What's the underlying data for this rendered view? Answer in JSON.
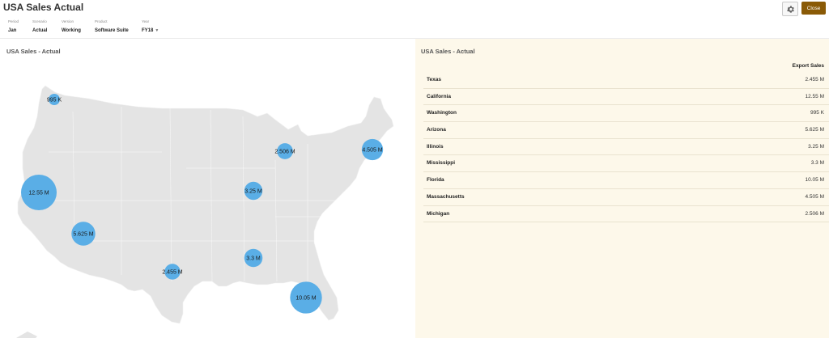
{
  "app": {
    "title": "USA Sales Actual",
    "close_label": "Close"
  },
  "icons": {
    "settings": "gear-icon",
    "year_dropdown": "chevron-down-icon"
  },
  "colors": {
    "bubble": "#5aaee6",
    "map_fill": "#e4e4e4",
    "close_button": "#8a5a06",
    "table_panel": "#fdf8ea"
  },
  "pov": [
    {
      "label": "Period",
      "value": "Jan"
    },
    {
      "label": "Scenario",
      "value": "Actual"
    },
    {
      "label": "Version",
      "value": "Working"
    },
    {
      "label": "Product",
      "value": "Software Suite"
    },
    {
      "label": "Year",
      "value": "FY18"
    }
  ],
  "map_panel": {
    "title": "USA Sales - Actual",
    "bubbles": [
      {
        "state": "Washington",
        "label": "995 K",
        "value": 995000
      },
      {
        "state": "California",
        "label": "12.55 M",
        "value": 12550000
      },
      {
        "state": "Arizona",
        "label": "5.625 M",
        "value": 5625000
      },
      {
        "state": "Texas",
        "label": "2.455 M",
        "value": 2455000
      },
      {
        "state": "Illinois",
        "label": "3.25 M",
        "value": 3250000
      },
      {
        "state": "Mississippi",
        "label": "3.3 M",
        "value": 3300000
      },
      {
        "state": "Michigan",
        "label": "2.506 M",
        "value": 2506000
      },
      {
        "state": "Massachusetts",
        "label": "4.505 M",
        "value": 4505000
      },
      {
        "state": "Florida",
        "label": "10.05 M",
        "value": 10050000
      }
    ]
  },
  "table_panel": {
    "title": "USA Sales - Actual",
    "column_header": "Export Sales",
    "rows": [
      {
        "name": "Texas",
        "value": "2.455 M"
      },
      {
        "name": "California",
        "value": "12.55 M"
      },
      {
        "name": "Washington",
        "value": "995 K"
      },
      {
        "name": "Arizona",
        "value": "5.625 M"
      },
      {
        "name": "Illinois",
        "value": "3.25 M"
      },
      {
        "name": "Mississippi",
        "value": "3.3 M"
      },
      {
        "name": "Florida",
        "value": "10.05 M"
      },
      {
        "name": "Massachusetts",
        "value": "4.505 M"
      },
      {
        "name": "Michigan",
        "value": "2.506 M"
      }
    ]
  }
}
